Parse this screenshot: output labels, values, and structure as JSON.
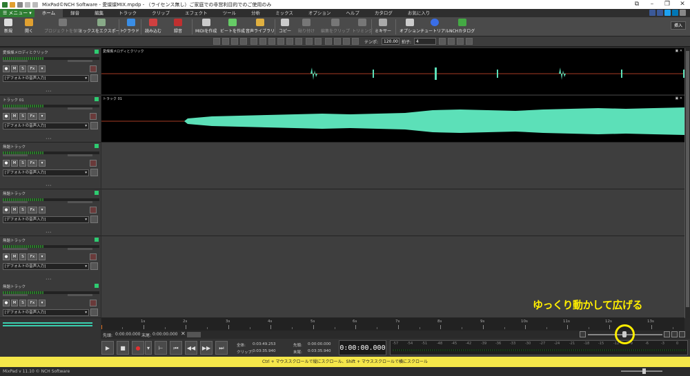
{
  "titlebar": {
    "title": "MixPad©NCH Software - 愛燦燦MIX.mpdp - （ライセンス無し）ご家庭での非営利目的でのご使用のみ"
  },
  "menu": {
    "menu_button": "メニュー",
    "tabs": [
      "ホーム",
      "録音",
      "編集",
      "トラック",
      "クリップ",
      "エフェクト",
      "ツール",
      "分析",
      "ミックス",
      "オプション",
      "ヘルプ",
      "カタログ",
      "お気に入り"
    ],
    "active_tab": "ホーム"
  },
  "ribbon": {
    "new": "新規",
    "open": "開く",
    "save_project": "プロジェクトを保存",
    "mix_export": "ミックスをエクスポート",
    "cloud": "クラウド",
    "load": "読み込む",
    "record": "録音",
    "midi": "MIDIを作成",
    "beat": "ビートを作成",
    "library": "音声ライブラリ",
    "copy": "コピー",
    "paste": "貼り付け",
    "replace_clip": "編集をクリップ",
    "trim": "トリミング",
    "mixer": "ミキサー",
    "options": "オプション",
    "tutorial": "チュートリアル",
    "nch_catalog": "NCHカタログ",
    "insert": "挿入"
  },
  "toolbar": {
    "tempo_label": "テンポ:",
    "tempo_value": "120.00",
    "beat_label": "拍子:",
    "beat_value": "4"
  },
  "tracks": [
    {
      "name": "愛燦燦メロディとクリック",
      "input": "[デフォルトの音声入力]",
      "lane_label": "愛燦燦メロディとクリック"
    },
    {
      "name": "トラック 01",
      "input": "[デフォルトの音声入力]",
      "lane_label": "トラック 01"
    },
    {
      "name": "無題トラック",
      "input": "[デフォルトの音声入力]",
      "lane_label": ""
    },
    {
      "name": "無題トラック",
      "input": "[デフォルトの音声入力]",
      "lane_label": ""
    },
    {
      "name": "無題トラック",
      "input": "[デフォルトの音声入力]",
      "lane_label": ""
    },
    {
      "name": "無題トラック",
      "input": "[デフォルトの音声入力]",
      "lane_label": ""
    }
  ],
  "track_buttons": {
    "mute": "M",
    "solo": "S",
    "fx": "Fx"
  },
  "ruler_ticks": [
    "1s",
    "2s",
    "3s",
    "4s",
    "5s",
    "6s",
    "7s",
    "8s",
    "9s",
    "10s",
    "11s",
    "12s",
    "13s"
  ],
  "position": {
    "start_label": "先頭:",
    "start_value": "0:00:00.000",
    "end_label": "末尾:",
    "end_value": "0:00:00.000"
  },
  "transport": {
    "total_label": "全体:",
    "total_value": "0:03:49.253",
    "clip_label": "クリップ:",
    "clip_value": "0:03:35.940",
    "sel_start_label": "先頭:",
    "sel_start_value": "0:00:00.000",
    "sel_end_label": "末尾:",
    "sel_end_value": "0:03:35.940",
    "time": "0:00:00.000"
  },
  "vu_scale": [
    "-57",
    "-54",
    "-51",
    "-48",
    "-45",
    "-42",
    "-39",
    "-36",
    "-33",
    "-30",
    "-27",
    "-24",
    "-21",
    "-18",
    "-15",
    "-12",
    "-9",
    "-6",
    "-3",
    "0"
  ],
  "zoom_level": 0.5,
  "status_text": "Ctrl + マウススクロールで縦にスクロール、Shift + マウススクロールで横にスクロール",
  "footer_text": "MixPad v 11.10 © NCH Software",
  "annotation_text": "ゆっくり動かして広げる",
  "colors": {
    "accent_green": "#2e7d32",
    "waveform": "#5ce0b8",
    "annotation": "#ffee00",
    "status_bar": "#f5e74a"
  }
}
